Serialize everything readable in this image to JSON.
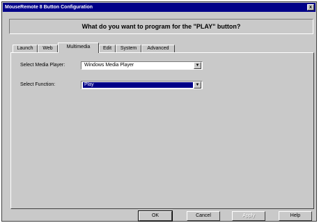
{
  "window": {
    "title": "MouseRemote 8 Button Configuration",
    "close_glyph": "x"
  },
  "question": "What do you want to program for the \"PLAY\" button?",
  "tabs": [
    {
      "label": "Launch",
      "active": false
    },
    {
      "label": "Web",
      "active": false
    },
    {
      "label": "Multimedia",
      "active": true
    },
    {
      "label": "Edit",
      "active": false
    },
    {
      "label": "System",
      "active": false
    },
    {
      "label": "Advanced",
      "active": false
    }
  ],
  "multimedia": {
    "media_player": {
      "label": "Select Media Player:",
      "value": "Windows Media Player"
    },
    "function": {
      "label": "Select Function:",
      "value": "Play"
    }
  },
  "buttons": {
    "ok": "OK",
    "cancel": "Cancel",
    "apply": "Apply",
    "help": "Help"
  },
  "colors": {
    "titlebar": "#000088",
    "face": "#c9c9c9",
    "selection": "#000088"
  }
}
